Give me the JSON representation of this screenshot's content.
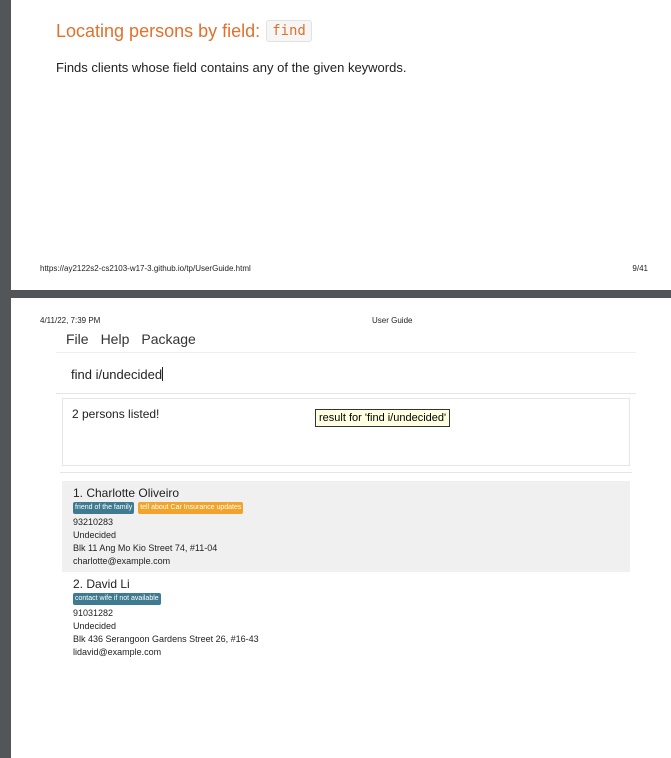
{
  "page1": {
    "heading_text": "Locating persons by field:",
    "heading_code": "find",
    "description": "Finds clients whose field contains any of the given keywords.",
    "footer_url": "https://ay2122s2-cs2103-w17-3.github.io/tp/UserGuide.html",
    "footer_page": "9/41"
  },
  "page2": {
    "header_date": "4/11/22, 7:39 PM",
    "header_title": "User Guide"
  },
  "app": {
    "menu": [
      "File",
      "Help",
      "Package"
    ],
    "command_input": "find i/undecided",
    "result_message": "2 persons listed!",
    "tooltip": "result for 'find i/undecided'",
    "persons": [
      {
        "index_name": "1.  Charlotte Oliveiro",
        "tags": [
          "friend of the family",
          "tell about Car Insurance updates"
        ],
        "phone": "93210283",
        "insurance": "Undecided",
        "address": "Blk 11 Ang Mo Kio Street 74, #11-04",
        "email": "charlotte@example.com"
      },
      {
        "index_name": "2.  David Li",
        "tags": [
          "contact wife if not available"
        ],
        "phone": "91031282",
        "insurance": "Undecided",
        "address": "Blk 436 Serangoon Gardens Street 26, #16-43",
        "email": "lidavid@example.com"
      }
    ]
  },
  "colors": {
    "heading": "#e3702b",
    "tag_blue": "#3e7b91",
    "tag_orange": "#f2a42a",
    "viewer_bg": "#525659"
  }
}
